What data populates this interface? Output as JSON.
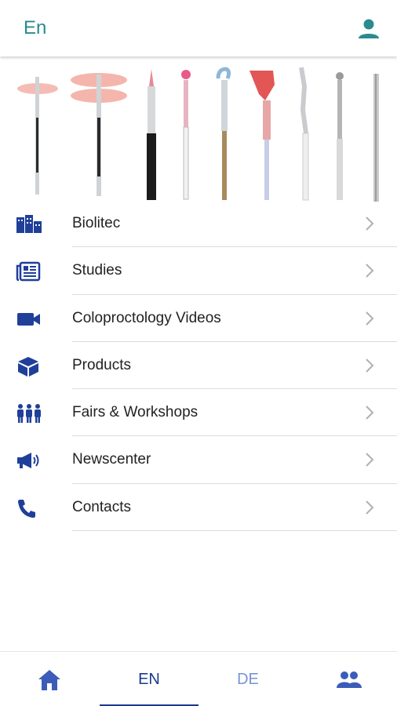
{
  "topbar": {
    "language": "En",
    "account_icon": "person-icon"
  },
  "banner": {
    "description_icon": "laser-fibers-image"
  },
  "menu": {
    "items": [
      {
        "label": "Biolitec",
        "icon": "buildings-icon"
      },
      {
        "label": "Studies",
        "icon": "newspaper-icon"
      },
      {
        "label": "Coloproctology Videos",
        "icon": "video-camera-icon"
      },
      {
        "label": "Products",
        "icon": "cube-icon"
      },
      {
        "label": "Fairs & Workshops",
        "icon": "group-icon"
      },
      {
        "label": "Newscenter",
        "icon": "megaphone-icon"
      },
      {
        "label": "Contacts",
        "icon": "phone-icon"
      }
    ]
  },
  "bottom_nav": {
    "en_label": "EN",
    "de_label": "DE",
    "home_icon": "home-icon",
    "people_icon": "people-icon"
  },
  "colors": {
    "accent_teal": "#2a8b8f",
    "icon_blue": "#1f3f99",
    "nav_active": "#1a3a8c",
    "nav_inactive": "#7a93d6"
  }
}
